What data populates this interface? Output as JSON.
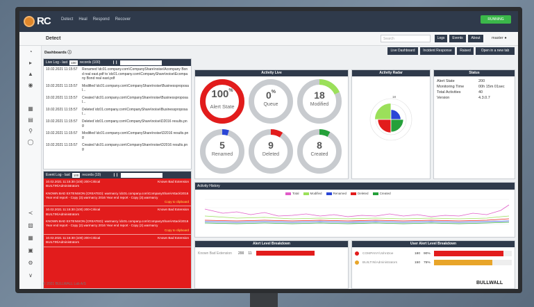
{
  "app": {
    "logo_text": "RC",
    "nav": [
      "Detect",
      "Heal",
      "Respond",
      "Recover"
    ],
    "status_button": "RUNNING"
  },
  "header": {
    "page_title": "Detect",
    "search_placeholder": "Search",
    "buttons": [
      "Logs",
      "Events",
      "About"
    ],
    "user": "master"
  },
  "toolbar": {
    "dashboards_label": "Dashboards",
    "buttons": [
      "Live Dashboard",
      "Incident Response",
      "Raised",
      "Open in a new tab"
    ]
  },
  "live_log": {
    "title": "Live Log - last",
    "count_select": "100",
    "records_label": "records (100)",
    "rows": [
      {
        "ts": "10.02.2021 11:15:57",
        "text": "Renamed \\dc01.company.com\\CompanyShare\\noise\\Acompany Bond real east.pdf to \\dc01.company.com\\CompanyShare\\noise\\Ecompany Bond real east.pdf"
      },
      {
        "ts": "10.02.2021 11:15:57",
        "text": "Modified \\dc01.company.com\\CompanyShare\\noise\\Businessproposal..."
      },
      {
        "ts": "10.02.2021 11:15:57",
        "text": "Created \\dc01.company.com\\CompanyShare\\noise\\Businessproposal..."
      },
      {
        "ts": "10.02.2021 11:15:57",
        "text": "Deleted \\dc01.company.com\\CompanyShare\\noise\\Businessproposal..."
      },
      {
        "ts": "10.02.2021 11:15:57",
        "text": "Deleted \\dc01.company.com\\CompanyShare\\noise\\D2016 results.png"
      },
      {
        "ts": "10.02.2021 11:15:57",
        "text": "Modified \\dc01.company.com\\CompanyShare\\noise\\D2016 results.png"
      },
      {
        "ts": "10.02.2021 11:15:57",
        "text": "Created \\dc01.company.com\\CompanyShare\\noise\\D2016 results.png"
      }
    ]
  },
  "event_log": {
    "title": "Event Log - last",
    "count_select": "100",
    "records_label": "records (10)",
    "rows": [
      {
        "ts": "10.02.2021 11:15:30",
        "level": "(100) 200-Critical",
        "tag": "Known Bad Extension",
        "user": "BUILTIN\\Administrators",
        "body": "KNOWN BAD EXTENSION (CREATED): warmarcy \\dc01.company.com\\CompanyShare\\Attack\\2016 Year end report - Copy (3).warmarcy 2016 Year end report - Copy (3).warmarcy",
        "copy": "Copy to clipboard"
      },
      {
        "ts": "10.02.2021 11:15:30",
        "level": "(100) 200-Critical",
        "tag": "Known Bad Extension",
        "user": "BUILTIN\\Administrators",
        "body": "KNOWN BAD EXTENSION (CREATED): warmarcy \\dc01.company.com\\CompanyShare\\Attack\\2016 Year end report - Copy (2).warmarcy 2016 Year end report - Copy (2).warmarcy",
        "copy": "Copy to clipboard"
      },
      {
        "ts": "10.02.2021 11:15:30",
        "level": "(100) 200-Critical",
        "tag": "Known Bad Extension",
        "user": "BUILTIN\\Administrators",
        "body": "",
        "copy": ""
      }
    ]
  },
  "activity_live": {
    "title": "Activity Live",
    "gauges": [
      {
        "value": "100",
        "suffix": "%",
        "label": "Alert State",
        "fraction": 1.0,
        "color": "#e21c1c",
        "big": true
      },
      {
        "value": "0",
        "suffix": "%",
        "label": "Queue",
        "fraction": 0.0,
        "color": "#c8cbcf",
        "big": false
      },
      {
        "value": "18",
        "suffix": "",
        "label": "Modified",
        "fraction": 0.18,
        "color": "#9be05a",
        "big": false
      },
      {
        "value": "5",
        "suffix": "",
        "label": "Renamed",
        "fraction": 0.05,
        "color": "#2a46d6",
        "big": false
      },
      {
        "value": "9",
        "suffix": "",
        "label": "Deleted",
        "fraction": 0.09,
        "color": "#e21c1c",
        "big": false
      },
      {
        "value": "8",
        "suffix": "",
        "label": "Created",
        "fraction": 0.08,
        "color": "#25a03a",
        "big": false
      }
    ]
  },
  "activity_radar": {
    "title": "Activity Radar",
    "scale_label": "18",
    "slices": [
      {
        "name": "Modified",
        "value": 18,
        "color": "#9be05a"
      },
      {
        "name": "Renamed",
        "value": 5,
        "color": "#2a46d6"
      },
      {
        "name": "Deleted",
        "value": 9,
        "color": "#e21c1c"
      },
      {
        "name": "Created",
        "value": 8,
        "color": "#25a03a"
      }
    ]
  },
  "status": {
    "title": "Status",
    "rows": [
      {
        "k": "Alert State",
        "v": "200"
      },
      {
        "k": "Monitoring Time",
        "v": "00h 15m 01sec"
      },
      {
        "k": "Total Activities",
        "v": "40"
      },
      {
        "k": "Version",
        "v": "4.3.0.7"
      }
    ]
  },
  "activity_history": {
    "title": "Activity History",
    "legend": [
      {
        "name": "Total",
        "color": "#e05cc8"
      },
      {
        "name": "Modified",
        "color": "#9be05a"
      },
      {
        "name": "Renamed",
        "color": "#2a46d6"
      },
      {
        "name": "Deleted",
        "color": "#e21c1c"
      },
      {
        "name": "Created",
        "color": "#25a03a"
      }
    ]
  },
  "alert_breakdown": {
    "title": "Alert Level Breakdown",
    "rows": [
      {
        "name": "Known Bad Extension",
        "level": "200",
        "count": "11"
      }
    ]
  },
  "user_breakdown": {
    "title": "User Alert Level Breakdown",
    "rows": [
      {
        "name": "COMPANY\\JohnDoe",
        "level": "180",
        "pct": "90%",
        "color": "#e21c1c",
        "fraction": 0.9
      },
      {
        "name": "BUILTIN\\Administrators",
        "level": "150",
        "pct": "75%",
        "color": "#e8a52a",
        "fraction": 0.75
      }
    ]
  },
  "footer": {
    "copyright": "© 2021 BULLWALL Lab A/S",
    "brand": "BULLWALL"
  }
}
